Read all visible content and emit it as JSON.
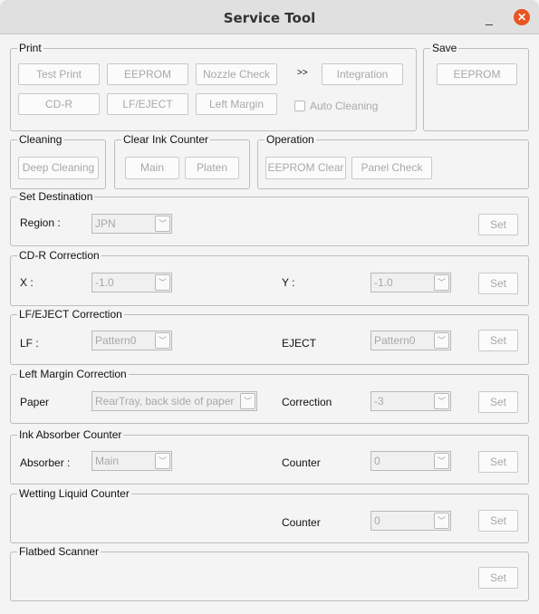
{
  "window": {
    "title": "Service Tool",
    "minimize": "_",
    "close": "✕"
  },
  "print": {
    "label": "Print",
    "test_print": "Test Print",
    "eeprom": "EEPROM",
    "nozzle_check": "Nozzle Check",
    "arrow": ">>",
    "integration": "Integration",
    "cdr": "CD-R",
    "lf_eject": "LF/EJECT",
    "left_margin": "Left Margin",
    "auto_cleaning": "Auto Cleaning"
  },
  "save": {
    "label": "Save",
    "eeprom": "EEPROM"
  },
  "cleaning": {
    "label": "Cleaning",
    "deep": "Deep Cleaning"
  },
  "clear_ink": {
    "label": "Clear Ink Counter",
    "main": "Main",
    "platen": "Platen"
  },
  "operation": {
    "label": "Operation",
    "eeprom_clear": "EEPROM Clear",
    "panel_check": "Panel Check"
  },
  "destination": {
    "label": "Set Destination",
    "region_label": "Region :",
    "region": "JPN",
    "set": "Set"
  },
  "cdr_corr": {
    "label": "CD-R Correction",
    "x_label": "X :",
    "x": "-1.0",
    "y_label": "Y :",
    "y": "-1.0",
    "set": "Set"
  },
  "lf_corr": {
    "label": "LF/EJECT Correction",
    "lf_label": "LF :",
    "lf": "Pattern0",
    "eject_label": "EJECT",
    "eject": "Pattern0",
    "set": "Set"
  },
  "lm_corr": {
    "label": "Left Margin Correction",
    "paper_label": "Paper",
    "paper": "RearTray, back side of paper",
    "corr_label": "Correction",
    "corr": "-3",
    "set": "Set"
  },
  "ink_abs": {
    "label": "Ink Absorber Counter",
    "abs_label": "Absorber :",
    "abs": "Main",
    "counter_label": "Counter",
    "counter": "0",
    "set": "Set"
  },
  "wetting": {
    "label": "Wetting Liquid Counter",
    "counter_label": "Counter",
    "counter": "0",
    "set": "Set"
  },
  "flatbed": {
    "label": "Flatbed Scanner",
    "set": "Set"
  }
}
